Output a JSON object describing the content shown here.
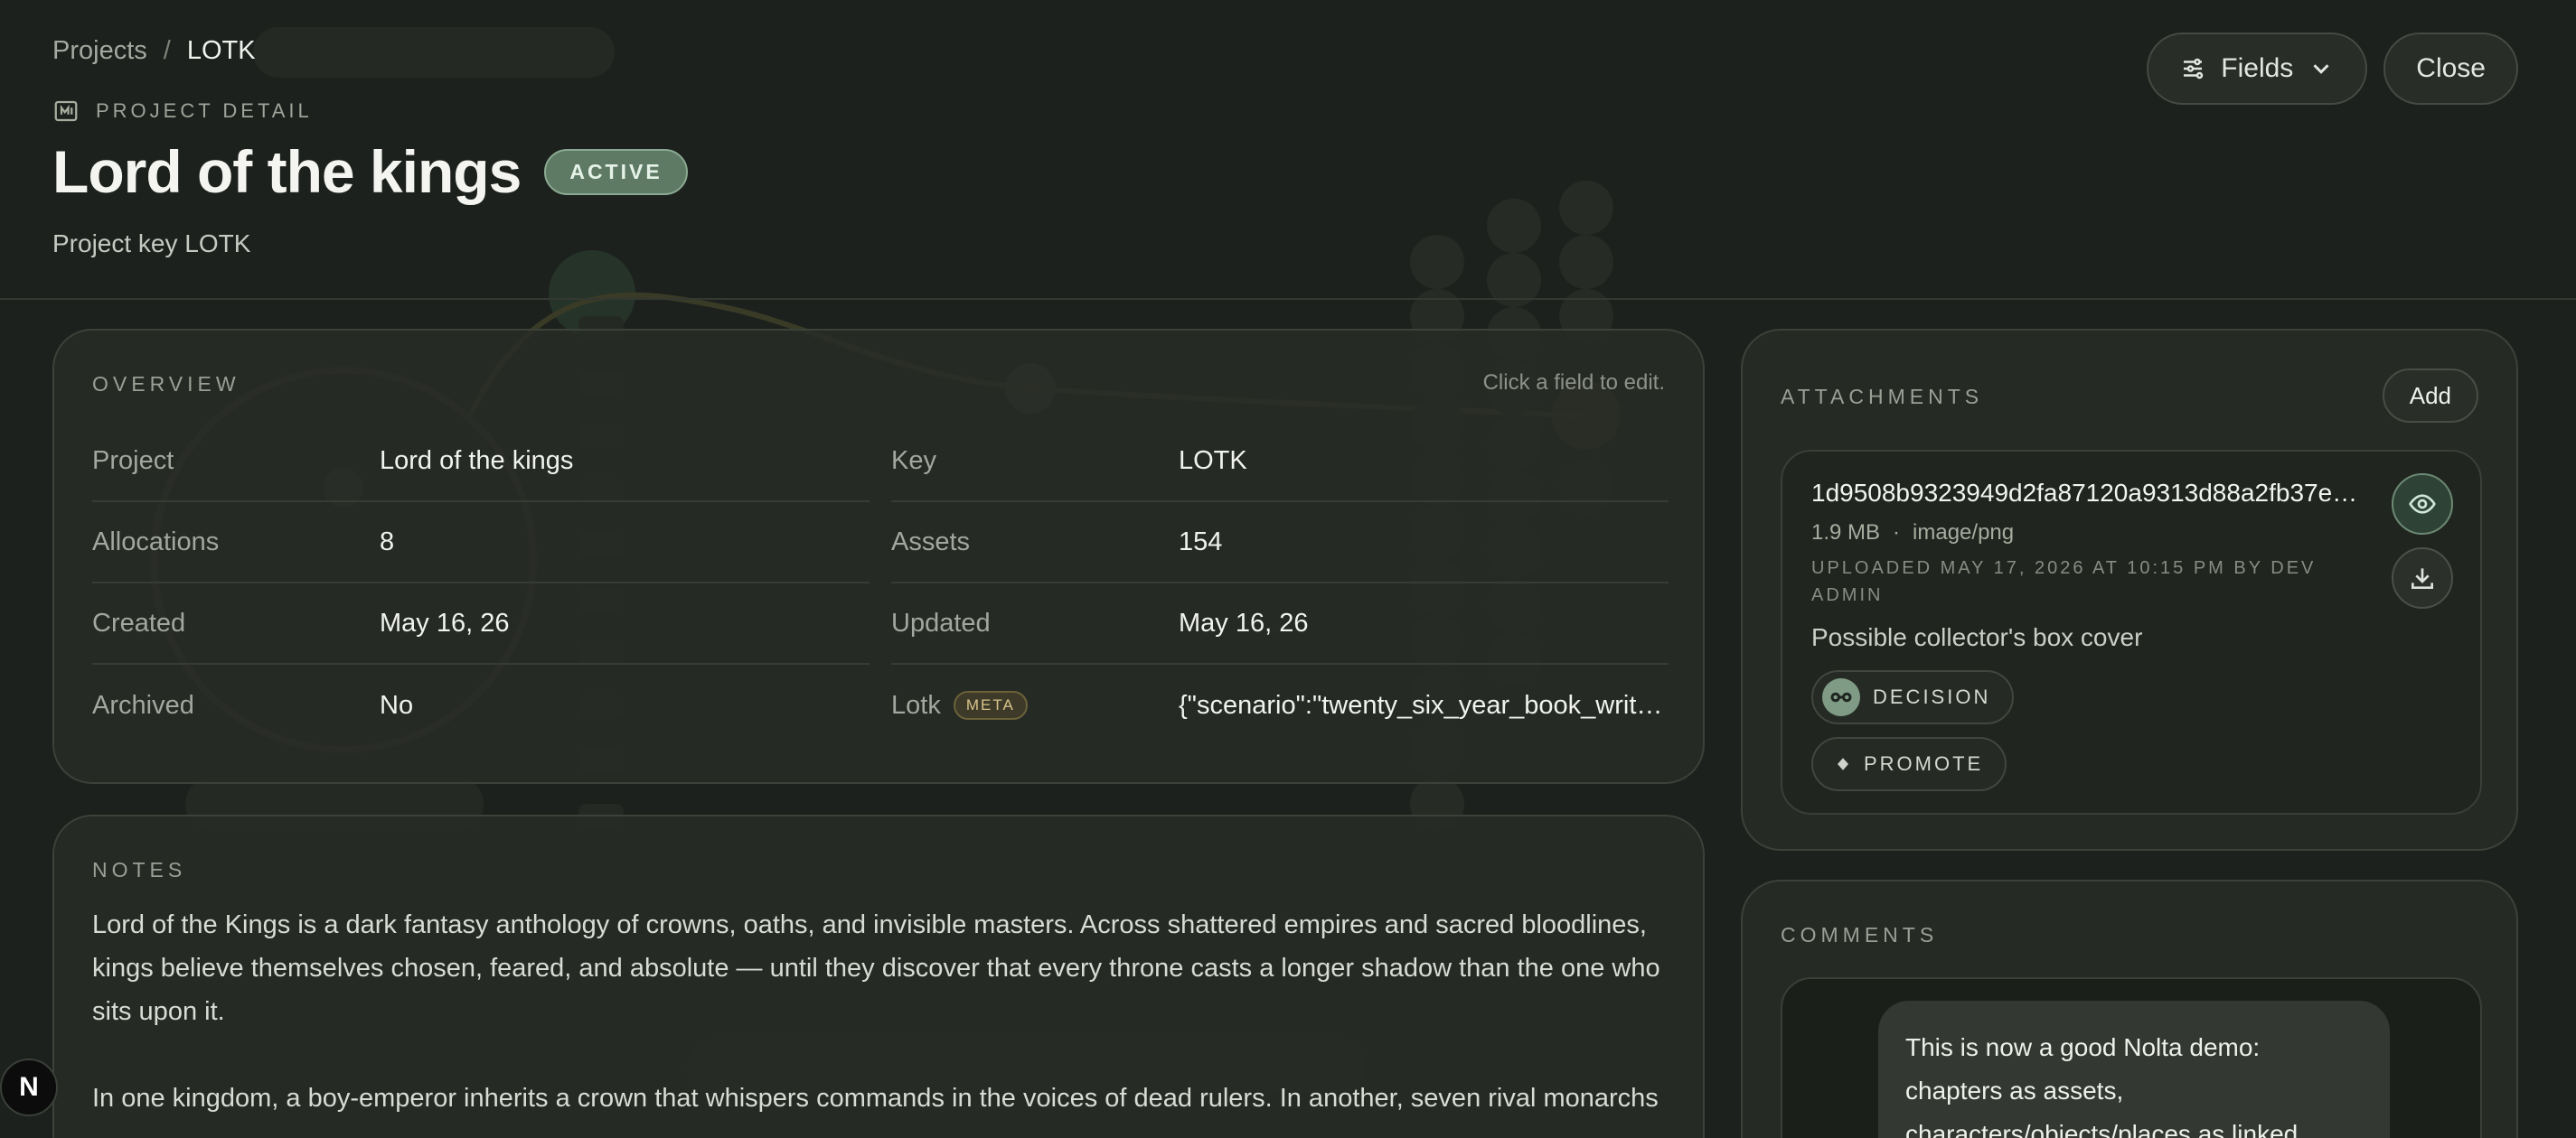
{
  "breadcrumb": {
    "parent": "Projects",
    "separator": "/",
    "current": "LOTK"
  },
  "header": {
    "eyebrow": "PROJECT DETAIL",
    "title": "Lord of the kings",
    "status": "ACTIVE",
    "subtitle": "Project key LOTK",
    "fields_button": "Fields",
    "close_button": "Close"
  },
  "overview": {
    "label": "OVERVIEW",
    "hint": "Click a field to edit.",
    "fields": [
      {
        "label": "Project",
        "value": "Lord of the kings"
      },
      {
        "label": "Key",
        "value": "LOTK"
      },
      {
        "label": "Allocations",
        "value": "8"
      },
      {
        "label": "Assets",
        "value": "154"
      },
      {
        "label": "Created",
        "value": "May 16, 26"
      },
      {
        "label": "Updated",
        "value": "May 16, 26"
      },
      {
        "label": "Archived",
        "value": "No"
      },
      {
        "label": "Lotk",
        "tag": "META",
        "value": "{\"scenario\":\"twenty_six_year_book_writ…"
      }
    ]
  },
  "notes": {
    "label": "NOTES",
    "paragraphs": [
      "Lord of the Kings is a dark fantasy anthology of crowns, oaths, and invisible masters. Across shattered empires and sacred bloodlines, kings believe themselves chosen, feared, and absolute — until they discover that every throne casts a longer shadow than the one who sits upon it.",
      "In one kingdom, a boy-emperor inherits a crown that whispers commands in the voices of dead rulers. In another, seven rival monarchs"
    ]
  },
  "attachments": {
    "label": "ATTACHMENTS",
    "add_button": "Add",
    "item": {
      "name": "1d9508b9323949d2fa87120a9313d88a2fb37e…",
      "size": "1.9 MB",
      "dot": "·",
      "type": "image/png",
      "uploaded": "UPLOADED MAY 17, 2026 AT 10:15 PM BY DEV ADMIN",
      "caption": "Possible collector's box cover",
      "chip_decision": "DECISION",
      "chip_promote": "PROMOTE"
    }
  },
  "comments": {
    "label": "COMMENTS",
    "message": "This is now a good Nolta demo: chapters as assets, characters/objects/places as linked"
  },
  "app_badge": "N",
  "colors": {
    "background": "#1d211d",
    "accent": "#7f9b86",
    "active_badge": "#5e7a65",
    "meta_tag": "#d8c38a"
  },
  "icons": [
    "project-detail-icon",
    "sliders-icon",
    "chevron-down-icon",
    "eye-icon",
    "download-icon",
    "decision-icon",
    "diamond-icon"
  ]
}
